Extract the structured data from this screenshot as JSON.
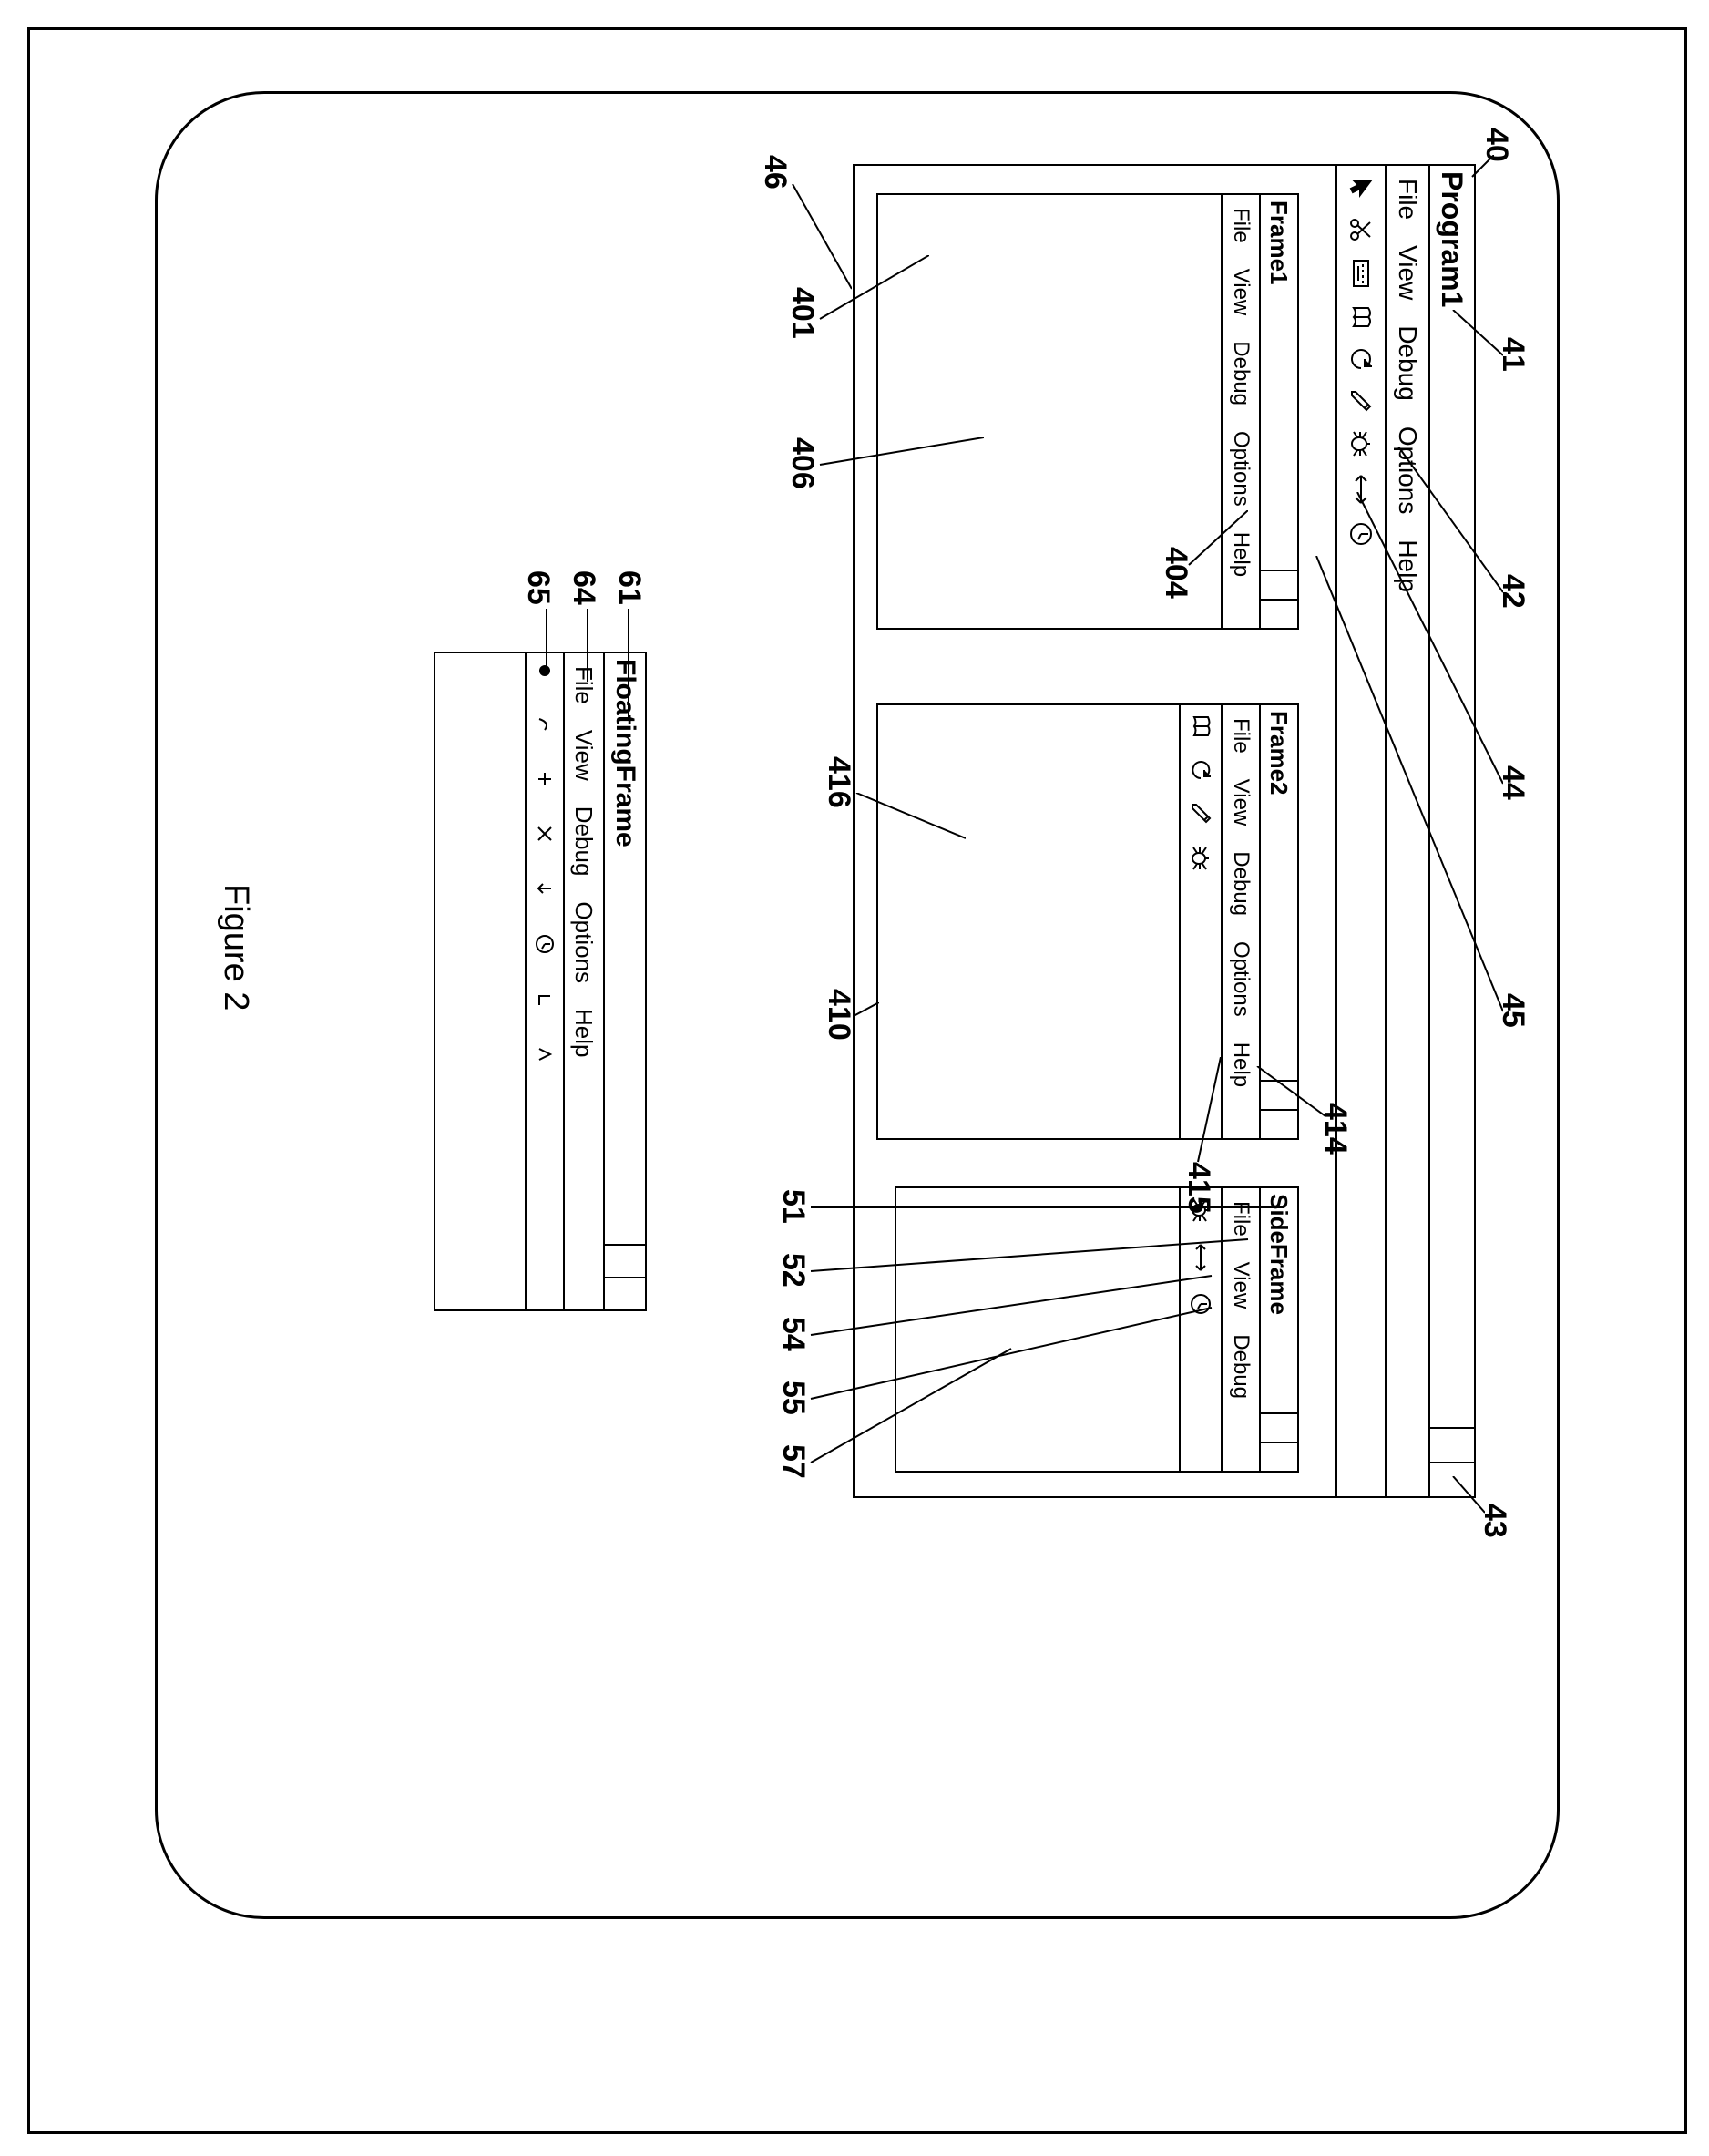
{
  "figure_caption": "Figure 2",
  "windows": {
    "program1": {
      "title": "Program1",
      "menu": [
        "File",
        "View",
        "Debug",
        "Options",
        "Help"
      ],
      "toolbar_icons": [
        "cursor",
        "scissors",
        "keyboard",
        "book",
        "refresh",
        "pencil",
        "bug",
        "arrow-lr",
        "clock"
      ]
    },
    "frame1": {
      "title": "Frame1",
      "menu": [
        "File",
        "View",
        "Debug",
        "Options",
        "Help"
      ]
    },
    "frame2": {
      "title": "Frame2",
      "menu": [
        "File",
        "View",
        "Debug",
        "Options",
        "Help"
      ],
      "toolbar_icons": [
        "book",
        "refresh",
        "pencil",
        "bug"
      ]
    },
    "sideframe": {
      "title": "SideFrame",
      "menu": [
        "File",
        "View",
        "Debug"
      ],
      "toolbar_icons": [
        "bug",
        "arrow-lr",
        "clock"
      ]
    },
    "floating": {
      "title": "FloatingFrame",
      "menu": [
        "File",
        "View",
        "Debug",
        "Options",
        "Help"
      ],
      "toolbar_icons": [
        "dot",
        "tool1",
        "tool2",
        "tool3",
        "tool4",
        "clock",
        "tool5",
        "tool6"
      ]
    }
  },
  "callouts": {
    "c40": "40",
    "c41": "41",
    "c42": "42",
    "c43": "43",
    "c44": "44",
    "c45": "45",
    "c46": "46",
    "c401": "401",
    "c404": "404",
    "c406": "406",
    "c410": "410",
    "c414": "414",
    "c415": "415",
    "c416": "416",
    "c51": "51",
    "c52": "52",
    "c54": "54",
    "c55": "55",
    "c57": "57",
    "c61": "61",
    "c64": "64",
    "c65": "65"
  }
}
